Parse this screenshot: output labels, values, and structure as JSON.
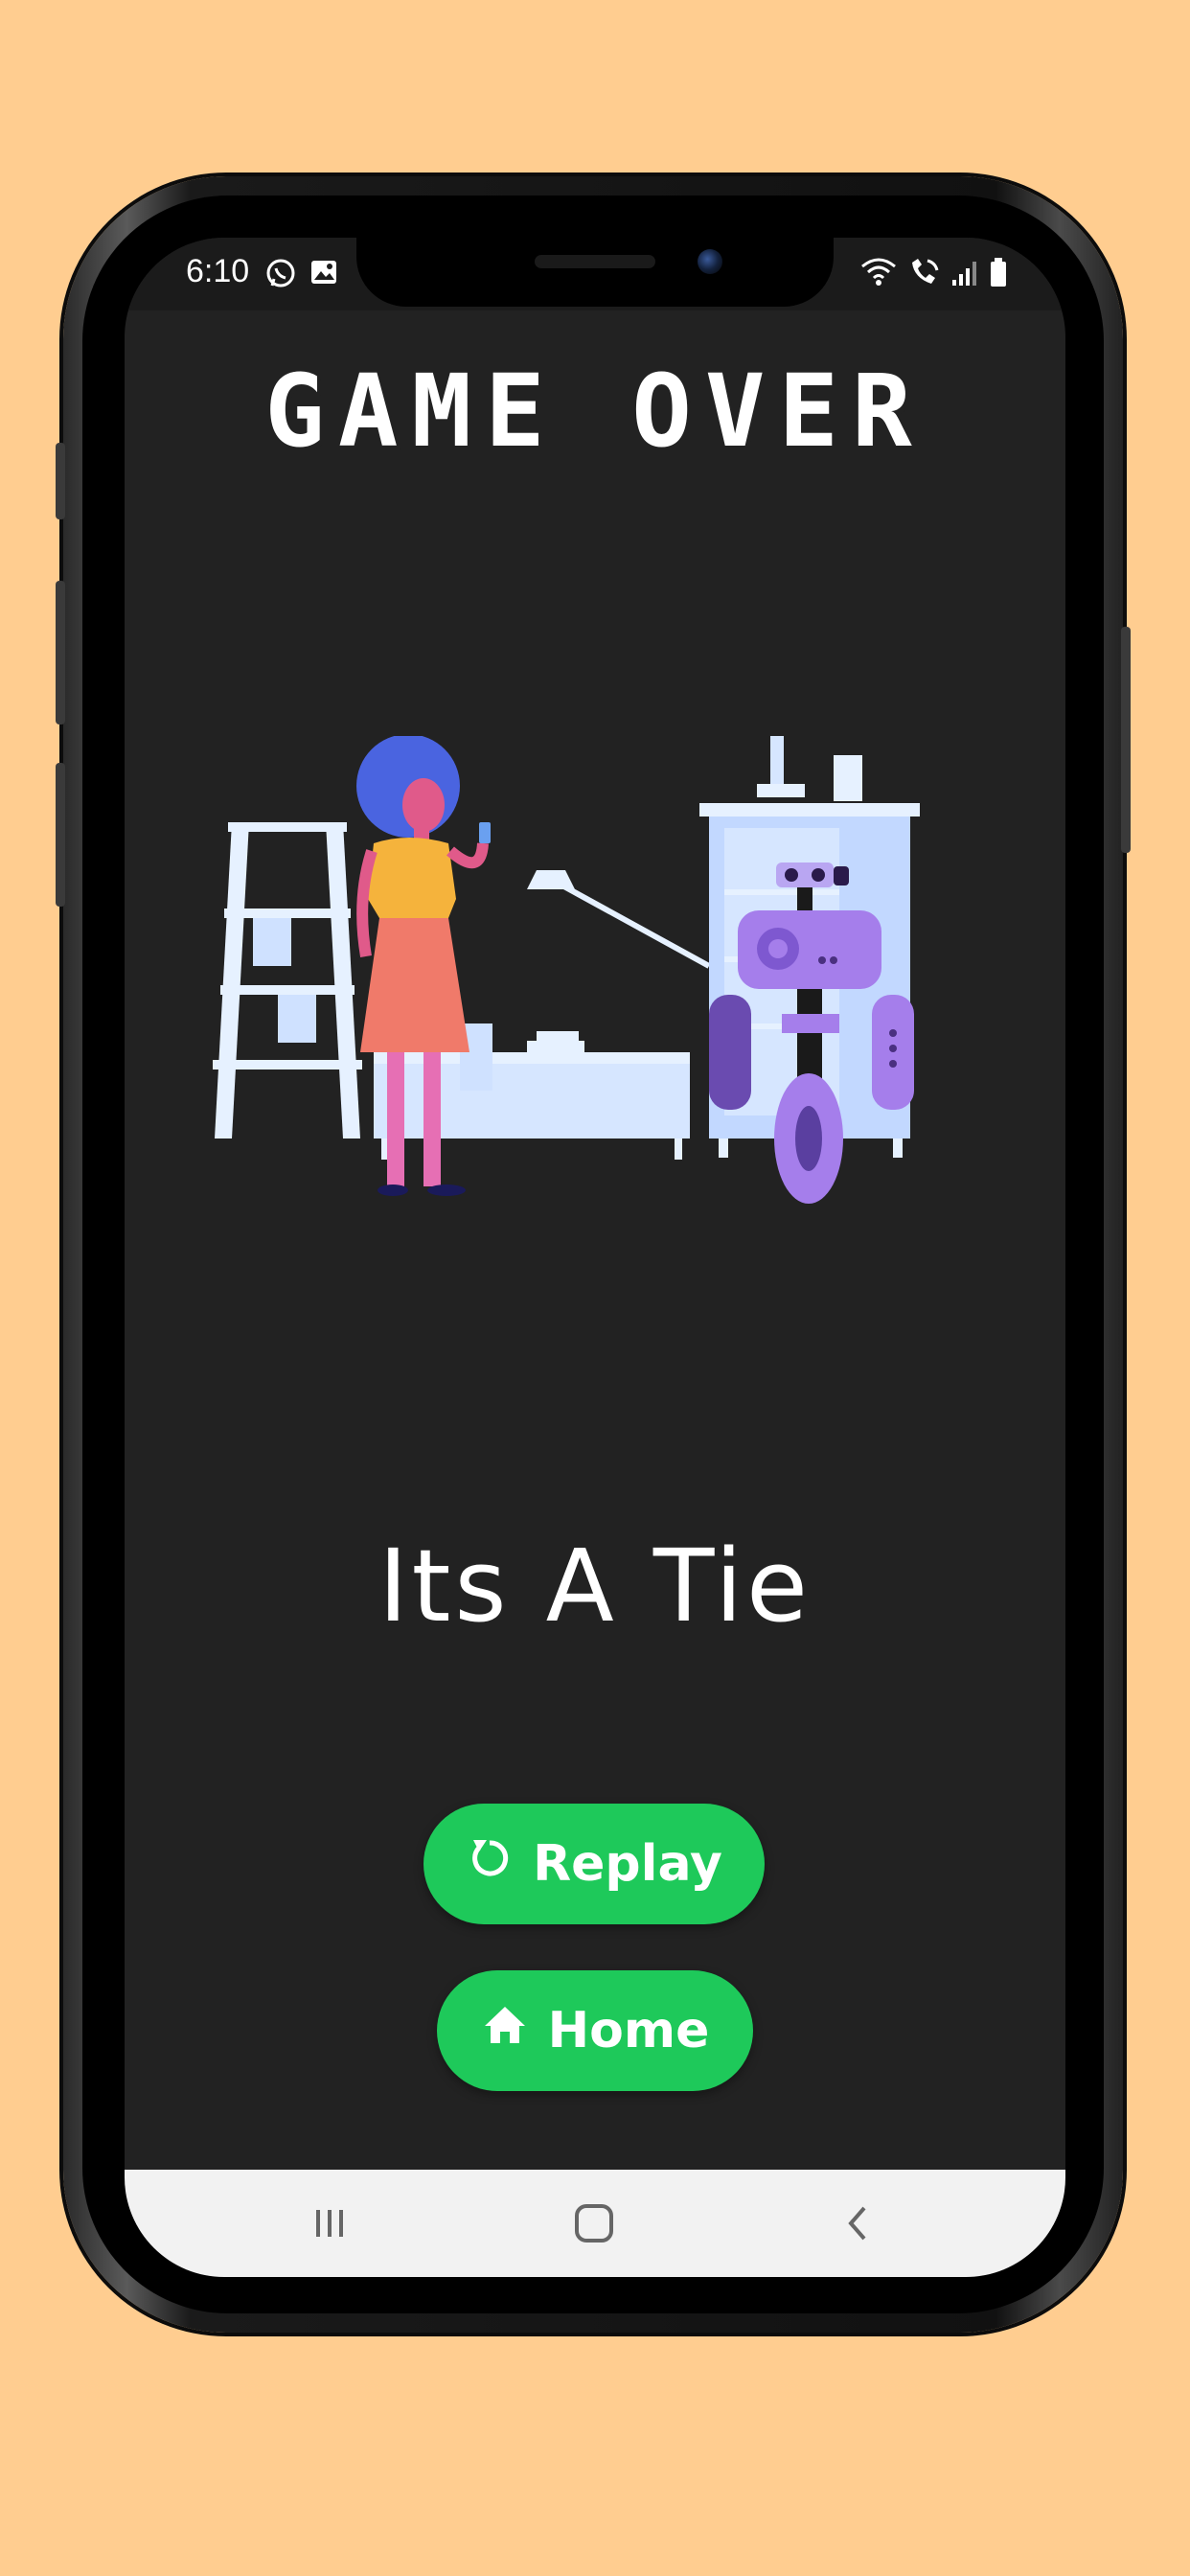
{
  "status_bar": {
    "time": "6:10",
    "left_icons": [
      "whatsapp-icon",
      "gallery-icon"
    ],
    "right_icons": [
      "wifi-icon",
      "wifi-calling-icon",
      "signal-icon",
      "battery-icon"
    ]
  },
  "game": {
    "title": "GAME OVER",
    "result": "Its A Tie"
  },
  "buttons": {
    "replay_label": "Replay",
    "home_label": "Home"
  },
  "nav_bar": {
    "items": [
      "recent-apps-icon",
      "home-icon",
      "back-icon"
    ]
  },
  "colors": {
    "background": "#FFCD90",
    "screen": "#222222",
    "button": "#1EC95A",
    "text": "#FFFFFF"
  }
}
